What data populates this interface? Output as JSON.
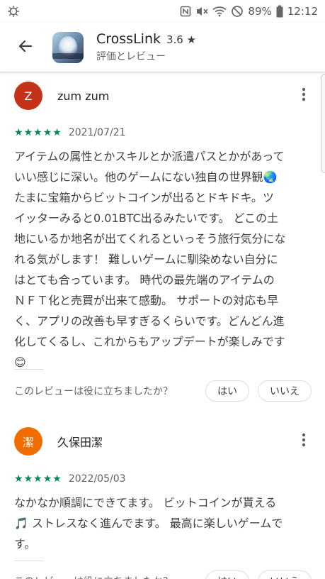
{
  "status_bar": {
    "battery": "89%",
    "time": "12:12"
  },
  "app": {
    "name": "CrossLink",
    "rating": "3.6",
    "star": "★",
    "subtitle": "評価とレビュー"
  },
  "helpful": {
    "question": "このレビューは役に立ちましたか？",
    "yes": "はい",
    "no": "いいえ"
  },
  "reviews": [
    {
      "avatar_letter": "Z",
      "avatar_color": "#c5321a",
      "name": "zum zum",
      "rating": 5,
      "date": "2021/07/21",
      "lines": [
        "アイテムの属性とかスキルとか派遣パスとかがあって",
        "いい感じに深い。他のゲームにない独自の世界観🌏",
        "たまに宝箱からビットコインが出るとドキドキ。ツ",
        "イッターみると0.01BTC出るみたいです。 どこの土",
        "地にいるか地名が出てくれるといっそう旅行気分にな",
        "れる気がします！ 難しいゲームに馴染めない自分に",
        "はとても合っています。 時代の最先端のアイテムの",
        "ＮＦＴ化と売買が出来て感動。 サポートの対応も早",
        "く、アプリの改善も早すぎるくらいです。どんどん進",
        "化してくるし、これからもアップデートが楽しみです",
        "😊"
      ]
    },
    {
      "avatar_letter": "潔",
      "avatar_color": "#ef6c00",
      "name": "久保田潔",
      "rating": 5,
      "date": "2022/05/03",
      "lines": [
        "なかなか順調にできてます。 ビットコインが貰える",
        "🎵 ストレスなく進んでます。 最高に楽しいゲームで",
        "す。"
      ]
    }
  ],
  "colors": {
    "star": "#01875f",
    "divider": "#dadce0"
  },
  "icons": [
    "nfc-icon",
    "mute-icon",
    "wifi-icon",
    "dnd-icon",
    "battery-icon",
    "back-arrow-icon",
    "more-vert-icon",
    "star-icon"
  ]
}
